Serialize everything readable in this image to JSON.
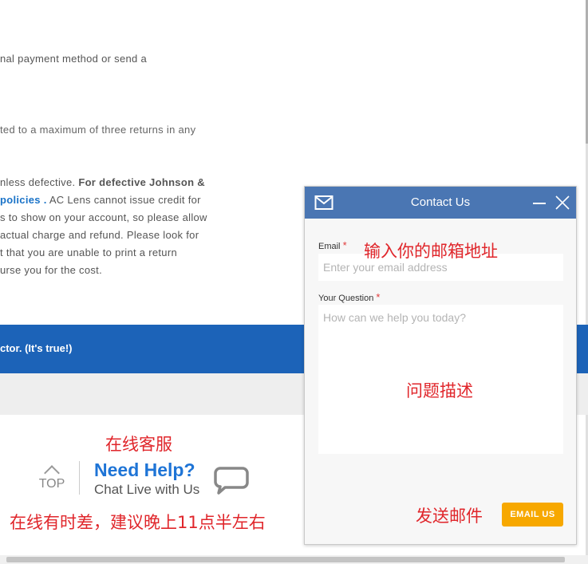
{
  "background_text": {
    "line1": "nal payment method or send a",
    "line2": "ted to a maximum of three returns in any",
    "line3a": "nless defective. ",
    "line3b": "For defective Johnson &",
    "line4a": "policies .",
    "line4b": " AC Lens cannot issue credit for",
    "line5": "s to show on your account, so please allow",
    "line6": "actual charge and refund. Please look for",
    "line7": "t that you are unable to print a return",
    "line8": "urse you for the cost."
  },
  "banner": {
    "text": "ctor. (It's true!)"
  },
  "footer": {
    "top_label": "TOP",
    "need_help": "Need Help?",
    "chat_live": "Chat Live with Us"
  },
  "annotations": {
    "online_service": "在线客服",
    "time_note": "在线有时差，建议晚上11点半左右",
    "email_note": "输入你的邮箱地址",
    "question_note": "问题描述",
    "send_note": "发送邮件"
  },
  "contact_widget": {
    "title": "Contact Us",
    "email_label": "Email",
    "required_mark": "*",
    "email_placeholder": "Enter your email address",
    "email_value": "",
    "question_label": "Your Question",
    "question_placeholder": "How can we help you today?",
    "question_value": "",
    "send_label": "EMAIL US"
  },
  "colors": {
    "header_blue": "#4a76b3",
    "band_blue": "#1c63b8",
    "link_blue": "#1e74d6",
    "send_orange": "#f7a800",
    "annotation_red": "#e0262b"
  },
  "icons": [
    "mail-icon",
    "minimize-icon",
    "close-icon",
    "chevron-up-icon",
    "chat-bubble-icon"
  ]
}
